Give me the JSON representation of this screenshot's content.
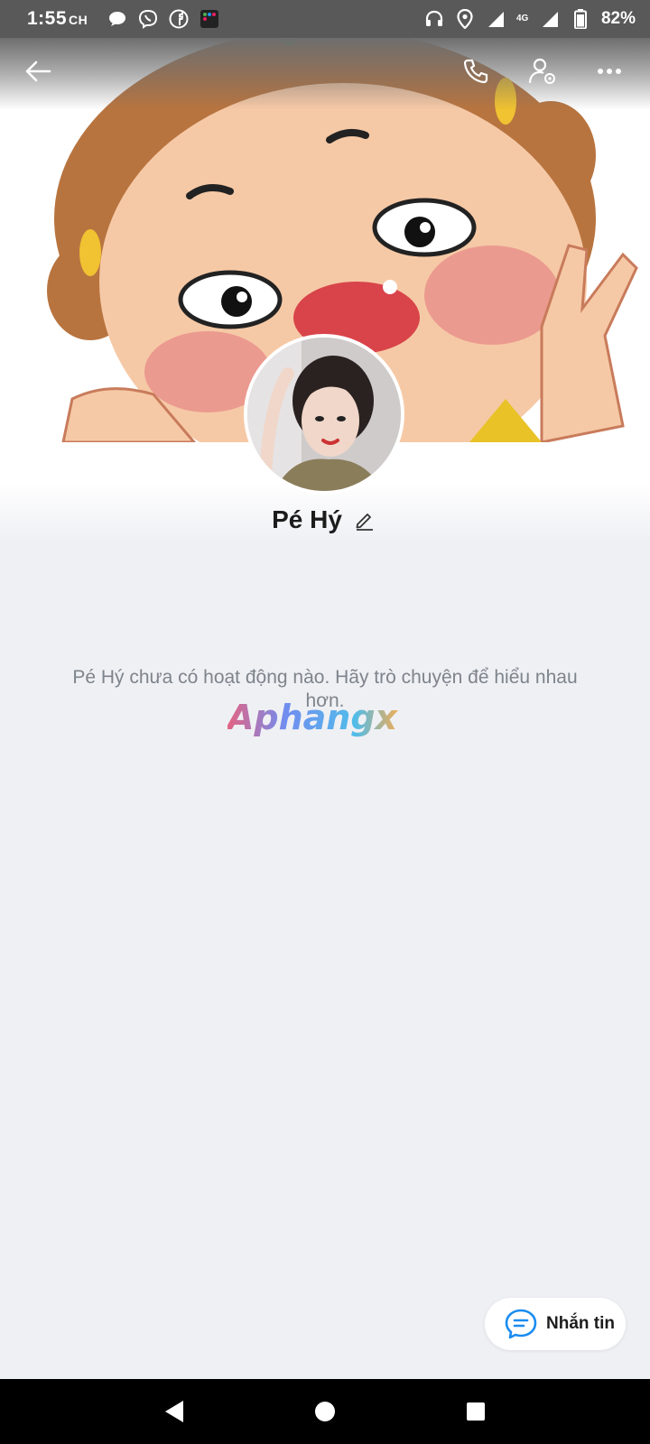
{
  "status_bar": {
    "time": "1:55",
    "time_suffix": "CH",
    "network": "4G",
    "battery": "82%",
    "left_icons": [
      "chat-bubble-icon",
      "viber-icon",
      "facebook-icon",
      "app-grid-icon"
    ],
    "right_icons": [
      "headphones-icon",
      "location-icon",
      "signal-icon",
      "signal-icon",
      "battery-icon"
    ]
  },
  "topbar": {
    "back_icon": "back-arrow-icon",
    "actions": [
      "phone-icon",
      "user-settings-icon",
      "more-icon"
    ]
  },
  "profile": {
    "name": "Pé Hý",
    "edit_icon": "pencil-icon"
  },
  "empty_state": {
    "message": "Pé Hý chưa có hoạt động nào. Hãy trò chuyện để hiểu nhau hơn."
  },
  "watermark": {
    "text": "Aphangx"
  },
  "message_button": {
    "label": "Nhắn tin",
    "icon": "message-icon"
  },
  "navbar": {
    "buttons": [
      "back-triangle-icon",
      "home-circle-icon",
      "recents-square-icon"
    ]
  },
  "colors": {
    "accent": "#1a8cf0",
    "status_bar": "#595959",
    "background": "#eff0f4",
    "text_muted": "#7e848c"
  }
}
